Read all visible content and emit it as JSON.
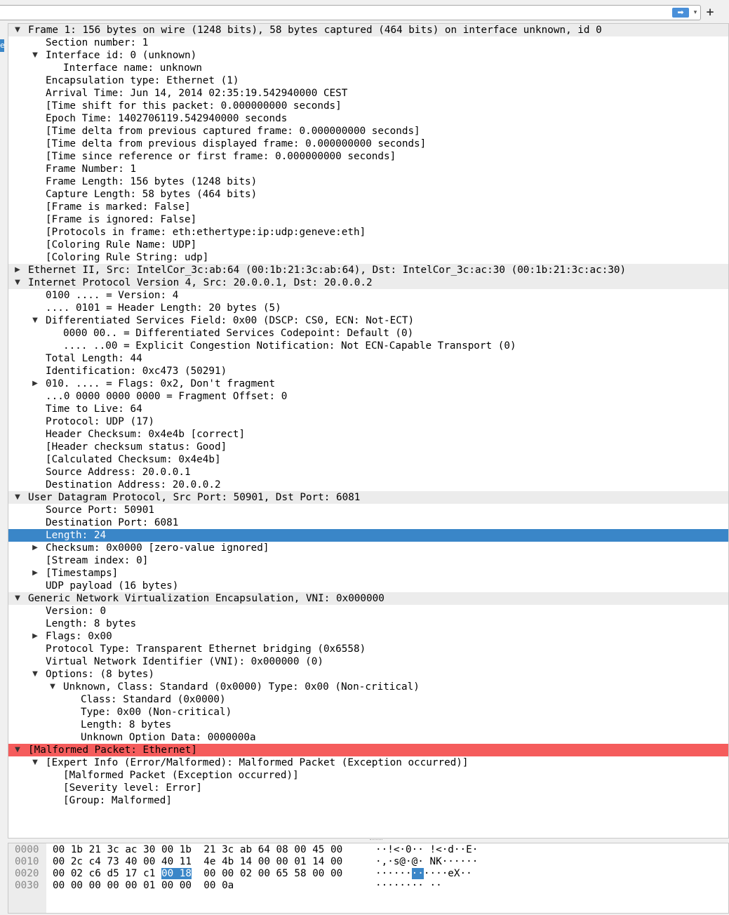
{
  "colors": {
    "selection": "#3a86c8",
    "error": "#f55c5c",
    "header_row": "#ececec"
  },
  "toolbar": {
    "filter_value": "",
    "apply_icon": "arrow-right-icon",
    "apply_glyph": "➡",
    "dropdown_glyph": "▾",
    "add_glyph": "+"
  },
  "left_tab_text": "e",
  "tree": [
    {
      "text": "Frame 1: 156 bytes on wire (1248 bits), 58 bytes captured (464 bits) on interface unknown, id 0",
      "level": 0,
      "exp": "open"
    },
    {
      "text": "Section number: 1",
      "level": 1
    },
    {
      "text": "Interface id: 0 (unknown)",
      "level": 1,
      "exp": "open"
    },
    {
      "text": "Interface name: unknown",
      "level": 2
    },
    {
      "text": "Encapsulation type: Ethernet (1)",
      "level": 1
    },
    {
      "text": "Arrival Time: Jun 14, 2014 02:35:19.542940000 CEST",
      "level": 1
    },
    {
      "text": "[Time shift for this packet: 0.000000000 seconds]",
      "level": 1
    },
    {
      "text": "Epoch Time: 1402706119.542940000 seconds",
      "level": 1
    },
    {
      "text": "[Time delta from previous captured frame: 0.000000000 seconds]",
      "level": 1
    },
    {
      "text": "[Time delta from previous displayed frame: 0.000000000 seconds]",
      "level": 1
    },
    {
      "text": "[Time since reference or first frame: 0.000000000 seconds]",
      "level": 1
    },
    {
      "text": "Frame Number: 1",
      "level": 1
    },
    {
      "text": "Frame Length: 156 bytes (1248 bits)",
      "level": 1
    },
    {
      "text": "Capture Length: 58 bytes (464 bits)",
      "level": 1
    },
    {
      "text": "[Frame is marked: False]",
      "level": 1
    },
    {
      "text": "[Frame is ignored: False]",
      "level": 1
    },
    {
      "text": "[Protocols in frame: eth:ethertype:ip:udp:geneve:eth]",
      "level": 1
    },
    {
      "text": "[Coloring Rule Name: UDP]",
      "level": 1
    },
    {
      "text": "[Coloring Rule String: udp]",
      "level": 1
    },
    {
      "text": "Ethernet II, Src: IntelCor_3c:ab:64 (00:1b:21:3c:ab:64), Dst: IntelCor_3c:ac:30 (00:1b:21:3c:ac:30)",
      "level": 0,
      "exp": "closed"
    },
    {
      "text": "Internet Protocol Version 4, Src: 20.0.0.1, Dst: 20.0.0.2",
      "level": 0,
      "exp": "open"
    },
    {
      "text": "0100 .... = Version: 4",
      "level": 1
    },
    {
      "text": ".... 0101 = Header Length: 20 bytes (5)",
      "level": 1
    },
    {
      "text": "Differentiated Services Field: 0x00 (DSCP: CS0, ECN: Not-ECT)",
      "level": 1,
      "exp": "open"
    },
    {
      "text": "0000 00.. = Differentiated Services Codepoint: Default (0)",
      "level": 2
    },
    {
      "text": ".... ..00 = Explicit Congestion Notification: Not ECN-Capable Transport (0)",
      "level": 2
    },
    {
      "text": "Total Length: 44",
      "level": 1
    },
    {
      "text": "Identification: 0xc473 (50291)",
      "level": 1
    },
    {
      "text": "010. .... = Flags: 0x2, Don't fragment",
      "level": 1,
      "exp": "closed"
    },
    {
      "text": "...0 0000 0000 0000 = Fragment Offset: 0",
      "level": 1
    },
    {
      "text": "Time to Live: 64",
      "level": 1
    },
    {
      "text": "Protocol: UDP (17)",
      "level": 1
    },
    {
      "text": "Header Checksum: 0x4e4b [correct]",
      "level": 1
    },
    {
      "text": "[Header checksum status: Good]",
      "level": 1
    },
    {
      "text": "[Calculated Checksum: 0x4e4b]",
      "level": 1
    },
    {
      "text": "Source Address: 20.0.0.1",
      "level": 1
    },
    {
      "text": "Destination Address: 20.0.0.2",
      "level": 1
    },
    {
      "text": "User Datagram Protocol, Src Port: 50901, Dst Port: 6081",
      "level": 0,
      "exp": "open"
    },
    {
      "text": "Source Port: 50901",
      "level": 1
    },
    {
      "text": "Destination Port: 6081",
      "level": 1
    },
    {
      "text": "Length: 24",
      "level": 1,
      "selected": true
    },
    {
      "text": "Checksum: 0x0000 [zero-value ignored]",
      "level": 1,
      "exp": "closed"
    },
    {
      "text": "[Stream index: 0]",
      "level": 1
    },
    {
      "text": "[Timestamps]",
      "level": 1,
      "exp": "closed"
    },
    {
      "text": "UDP payload (16 bytes)",
      "level": 1
    },
    {
      "text": "Generic Network Virtualization Encapsulation, VNI: 0x000000",
      "level": 0,
      "exp": "open"
    },
    {
      "text": "Version: 0",
      "level": 1
    },
    {
      "text": "Length: 8 bytes",
      "level": 1
    },
    {
      "text": "Flags: 0x00",
      "level": 1,
      "exp": "closed"
    },
    {
      "text": "Protocol Type: Transparent Ethernet bridging (0x6558)",
      "level": 1
    },
    {
      "text": "Virtual Network Identifier (VNI): 0x000000 (0)",
      "level": 1
    },
    {
      "text": "Options: (8 bytes)",
      "level": 1,
      "exp": "open"
    },
    {
      "text": "Unknown, Class: Standard (0x0000) Type: 0x00 (Non-critical)",
      "level": 2,
      "exp": "open"
    },
    {
      "text": "Class: Standard (0x0000)",
      "level": 3
    },
    {
      "text": "Type: 0x00 (Non-critical)",
      "level": 3
    },
    {
      "text": "Length: 8 bytes",
      "level": 3
    },
    {
      "text": "Unknown Option Data: 0000000a",
      "level": 3
    },
    {
      "text": "[Malformed Packet: Ethernet]",
      "level": 0,
      "exp": "open",
      "error": true
    },
    {
      "text": "[Expert Info (Error/Malformed): Malformed Packet (Exception occurred)]",
      "level": 1,
      "exp": "open"
    },
    {
      "text": "[Malformed Packet (Exception occurred)]",
      "level": 2
    },
    {
      "text": "[Severity level: Error]",
      "level": 2
    },
    {
      "text": "[Group: Malformed]",
      "level": 2
    }
  ],
  "hex": [
    {
      "offset": "0000",
      "bytes": [
        "00",
        "1b",
        "21",
        "3c",
        "ac",
        "30",
        "00",
        "1b",
        "21",
        "3c",
        "ab",
        "64",
        "08",
        "00",
        "45",
        "00"
      ],
      "ascii": [
        "··!<·0··",
        "!<·d··E·"
      ]
    },
    {
      "offset": "0010",
      "bytes": [
        "00",
        "2c",
        "c4",
        "73",
        "40",
        "00",
        "40",
        "11",
        "4e",
        "4b",
        "14",
        "00",
        "00",
        "01",
        "14",
        "00"
      ],
      "ascii": [
        "·,·s@·@·",
        "NK······"
      ]
    },
    {
      "offset": "0020",
      "bytes": [
        "00",
        "02",
        "c6",
        "d5",
        "17",
        "c1",
        "00",
        "18",
        "00",
        "00",
        "02",
        "00",
        "65",
        "58",
        "00",
        "00"
      ],
      "ascii": [
        "······",
        "··",
        "····eX··"
      ],
      "highlight_bytes": [
        6,
        7
      ],
      "highlight_ascii": 1
    },
    {
      "offset": "0030",
      "bytes": [
        "00",
        "00",
        "00",
        "00",
        "00",
        "01",
        "00",
        "00",
        "00",
        "0a"
      ],
      "ascii": [
        "········",
        "··"
      ]
    }
  ]
}
